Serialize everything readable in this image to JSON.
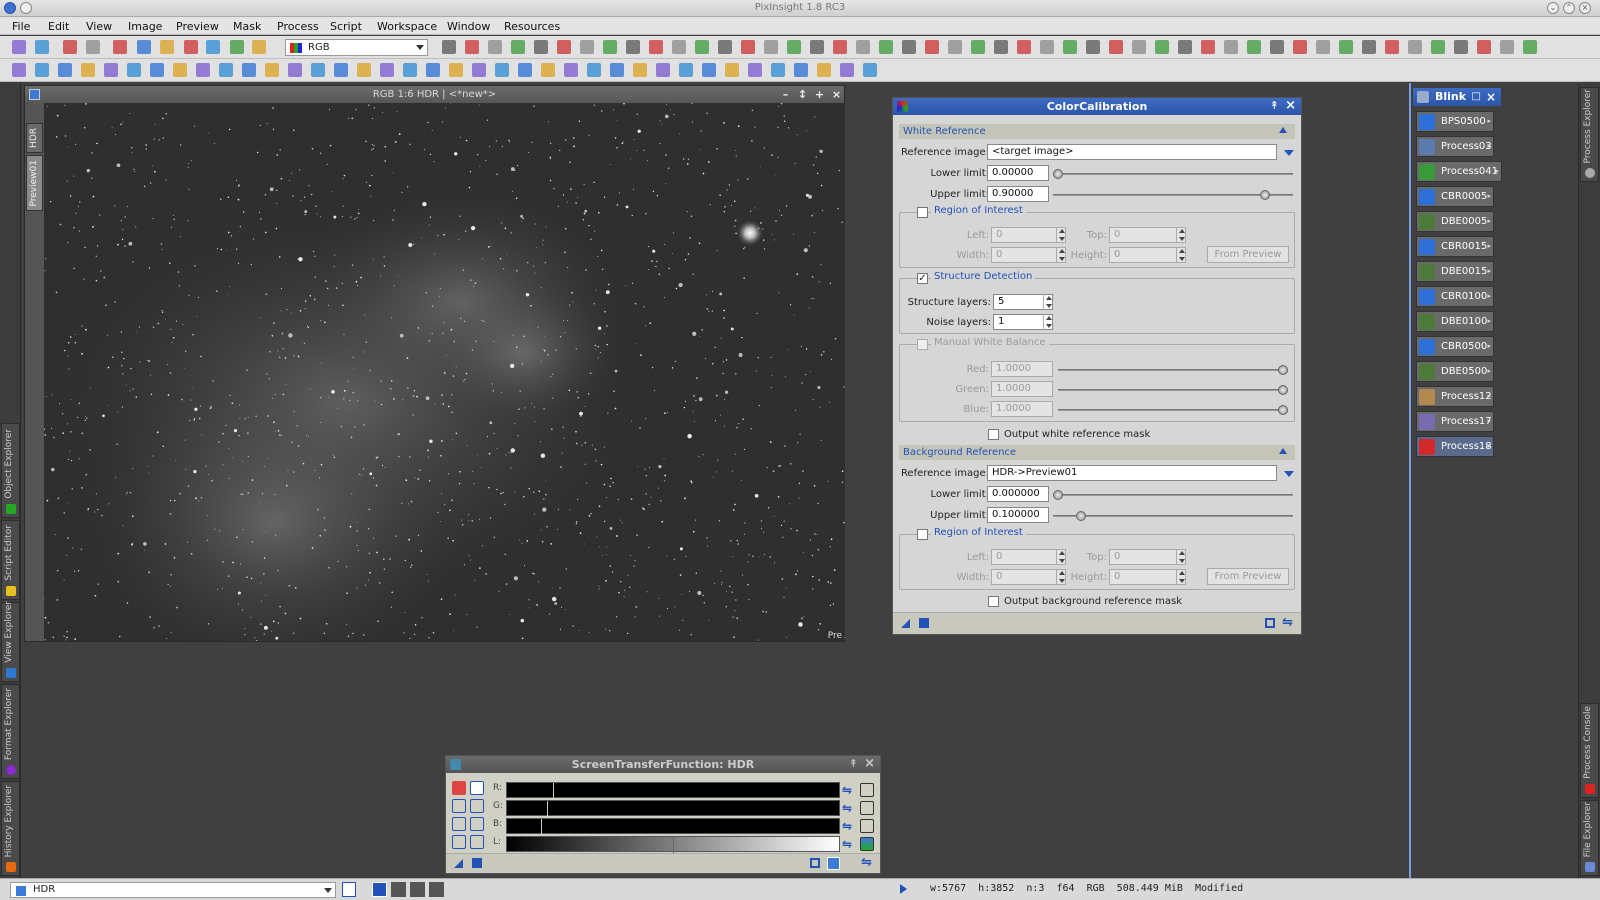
{
  "app": {
    "title": "PixInsight 1.8 RC3"
  },
  "menu": [
    "File",
    "Edit",
    "View",
    "Image",
    "Preview",
    "Mask",
    "Process",
    "Script",
    "Workspace",
    "Window",
    "Resources"
  ],
  "toolbar": {
    "channel_select": "RGB"
  },
  "left_dock": {
    "tabs": [
      "Object Explorer",
      "Script Editor",
      "View Explorer",
      "Format Explorer",
      "History Explorer"
    ]
  },
  "right_dock": {
    "tabs": [
      "Process Explorer",
      "Process Console",
      "File Explorer"
    ]
  },
  "image_window": {
    "title": "RGB 1:6 HDR | <*new*>",
    "side_tabs": [
      "HDR",
      "Preview01"
    ],
    "corner_label": "Pre"
  },
  "color_calibration": {
    "title": "ColorCalibration",
    "white_reference": {
      "section": "White Reference",
      "reference_image_label": "Reference image:",
      "reference_image": "<target image>",
      "lower_limit_label": "Lower limit:",
      "lower_limit": "0.00000",
      "lower_limit_pos": 0.0,
      "upper_limit_label": "Upper limit:",
      "upper_limit": "0.90000",
      "upper_limit_pos": 0.9
    },
    "roi1": {
      "title": "Region of Interest",
      "checked": false,
      "left_label": "Left:",
      "left": "0",
      "top_label": "Top:",
      "top": "0",
      "width_label": "Width:",
      "width": "0",
      "height_label": "Height:",
      "height": "0",
      "from_preview": "From Preview"
    },
    "structure_detection": {
      "title": "Structure Detection",
      "checked": true,
      "structure_layers_label": "Structure layers:",
      "structure_layers": "5",
      "noise_layers_label": "Noise layers:",
      "noise_layers": "1"
    },
    "manual_wb": {
      "title": "Manual White Balance",
      "checked": false,
      "red_label": "Red:",
      "red": "1.0000",
      "green_label": "Green:",
      "green": "1.0000",
      "blue_label": "Blue:",
      "blue": "1.0000"
    },
    "output_white_mask": "Output white reference mask",
    "background_reference": {
      "section": "Background Reference",
      "reference_image_label": "Reference image:",
      "reference_image": "HDR->Preview01",
      "lower_limit_label": "Lower limit:",
      "lower_limit": "0.000000",
      "lower_limit_pos": 0.0,
      "upper_limit_label": "Upper limit:",
      "upper_limit": "0.100000",
      "upper_limit_pos": 0.1
    },
    "roi2": {
      "title": "Region of Interest",
      "checked": false,
      "left_label": "Left:",
      "left": "0",
      "top_label": "Top:",
      "top": "0",
      "width_label": "Width:",
      "width": "0",
      "height_label": "Height:",
      "height": "0",
      "from_preview": "From Preview"
    },
    "output_background_mask": "Output background reference mask"
  },
  "blink": {
    "title": "Blink"
  },
  "process_icons": [
    {
      "label": "BPS0500",
      "color": "#2c6fd6"
    },
    {
      "label": "Process03",
      "color": "#5a7ab0"
    },
    {
      "label": "Process041",
      "color": "#3a9a3a"
    },
    {
      "label": "CBR0005",
      "color": "#2c6fd6"
    },
    {
      "label": "DBE0005",
      "color": "#4d7a3a"
    },
    {
      "label": "CBR0015",
      "color": "#2c6fd6"
    },
    {
      "label": "DBE0015",
      "color": "#4d7a3a"
    },
    {
      "label": "CBR0100",
      "color": "#2c6fd6"
    },
    {
      "label": "DBE0100",
      "color": "#4d7a3a"
    },
    {
      "label": "CBR0500",
      "color": "#2c6fd6"
    },
    {
      "label": "DBE0500",
      "color": "#4d7a3a"
    },
    {
      "label": "Process12",
      "color": "#b08a50"
    },
    {
      "label": "Process17",
      "color": "#7a6ab0"
    },
    {
      "label": "Process18",
      "color": "#d22a2a"
    }
  ],
  "stf": {
    "title": "ScreenTransferFunction: HDR",
    "channels": [
      "R:",
      "G:",
      "B:",
      "L:"
    ]
  },
  "status": {
    "view": "HDR",
    "width": "w:5767",
    "height": "h:3852",
    "channels": "n:3",
    "format": "f64",
    "colorspace": "RGB",
    "size": "508.449 MiB",
    "state": "Modified"
  }
}
